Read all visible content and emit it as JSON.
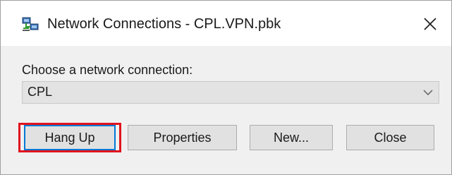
{
  "window": {
    "title": "Network Connections - CPL.VPN.pbk",
    "title_icon": "network-connections-icon",
    "close_icon": "close-icon"
  },
  "form": {
    "label": "Choose a network connection:",
    "connection_selected": "CPL",
    "dropdown_icon": "chevron-down-icon"
  },
  "buttons": {
    "hang_up": "Hang Up",
    "properties": "Properties",
    "new": "New...",
    "close": "Close"
  },
  "colors": {
    "highlight": "#e0141e",
    "focus_border": "#0078d7"
  }
}
